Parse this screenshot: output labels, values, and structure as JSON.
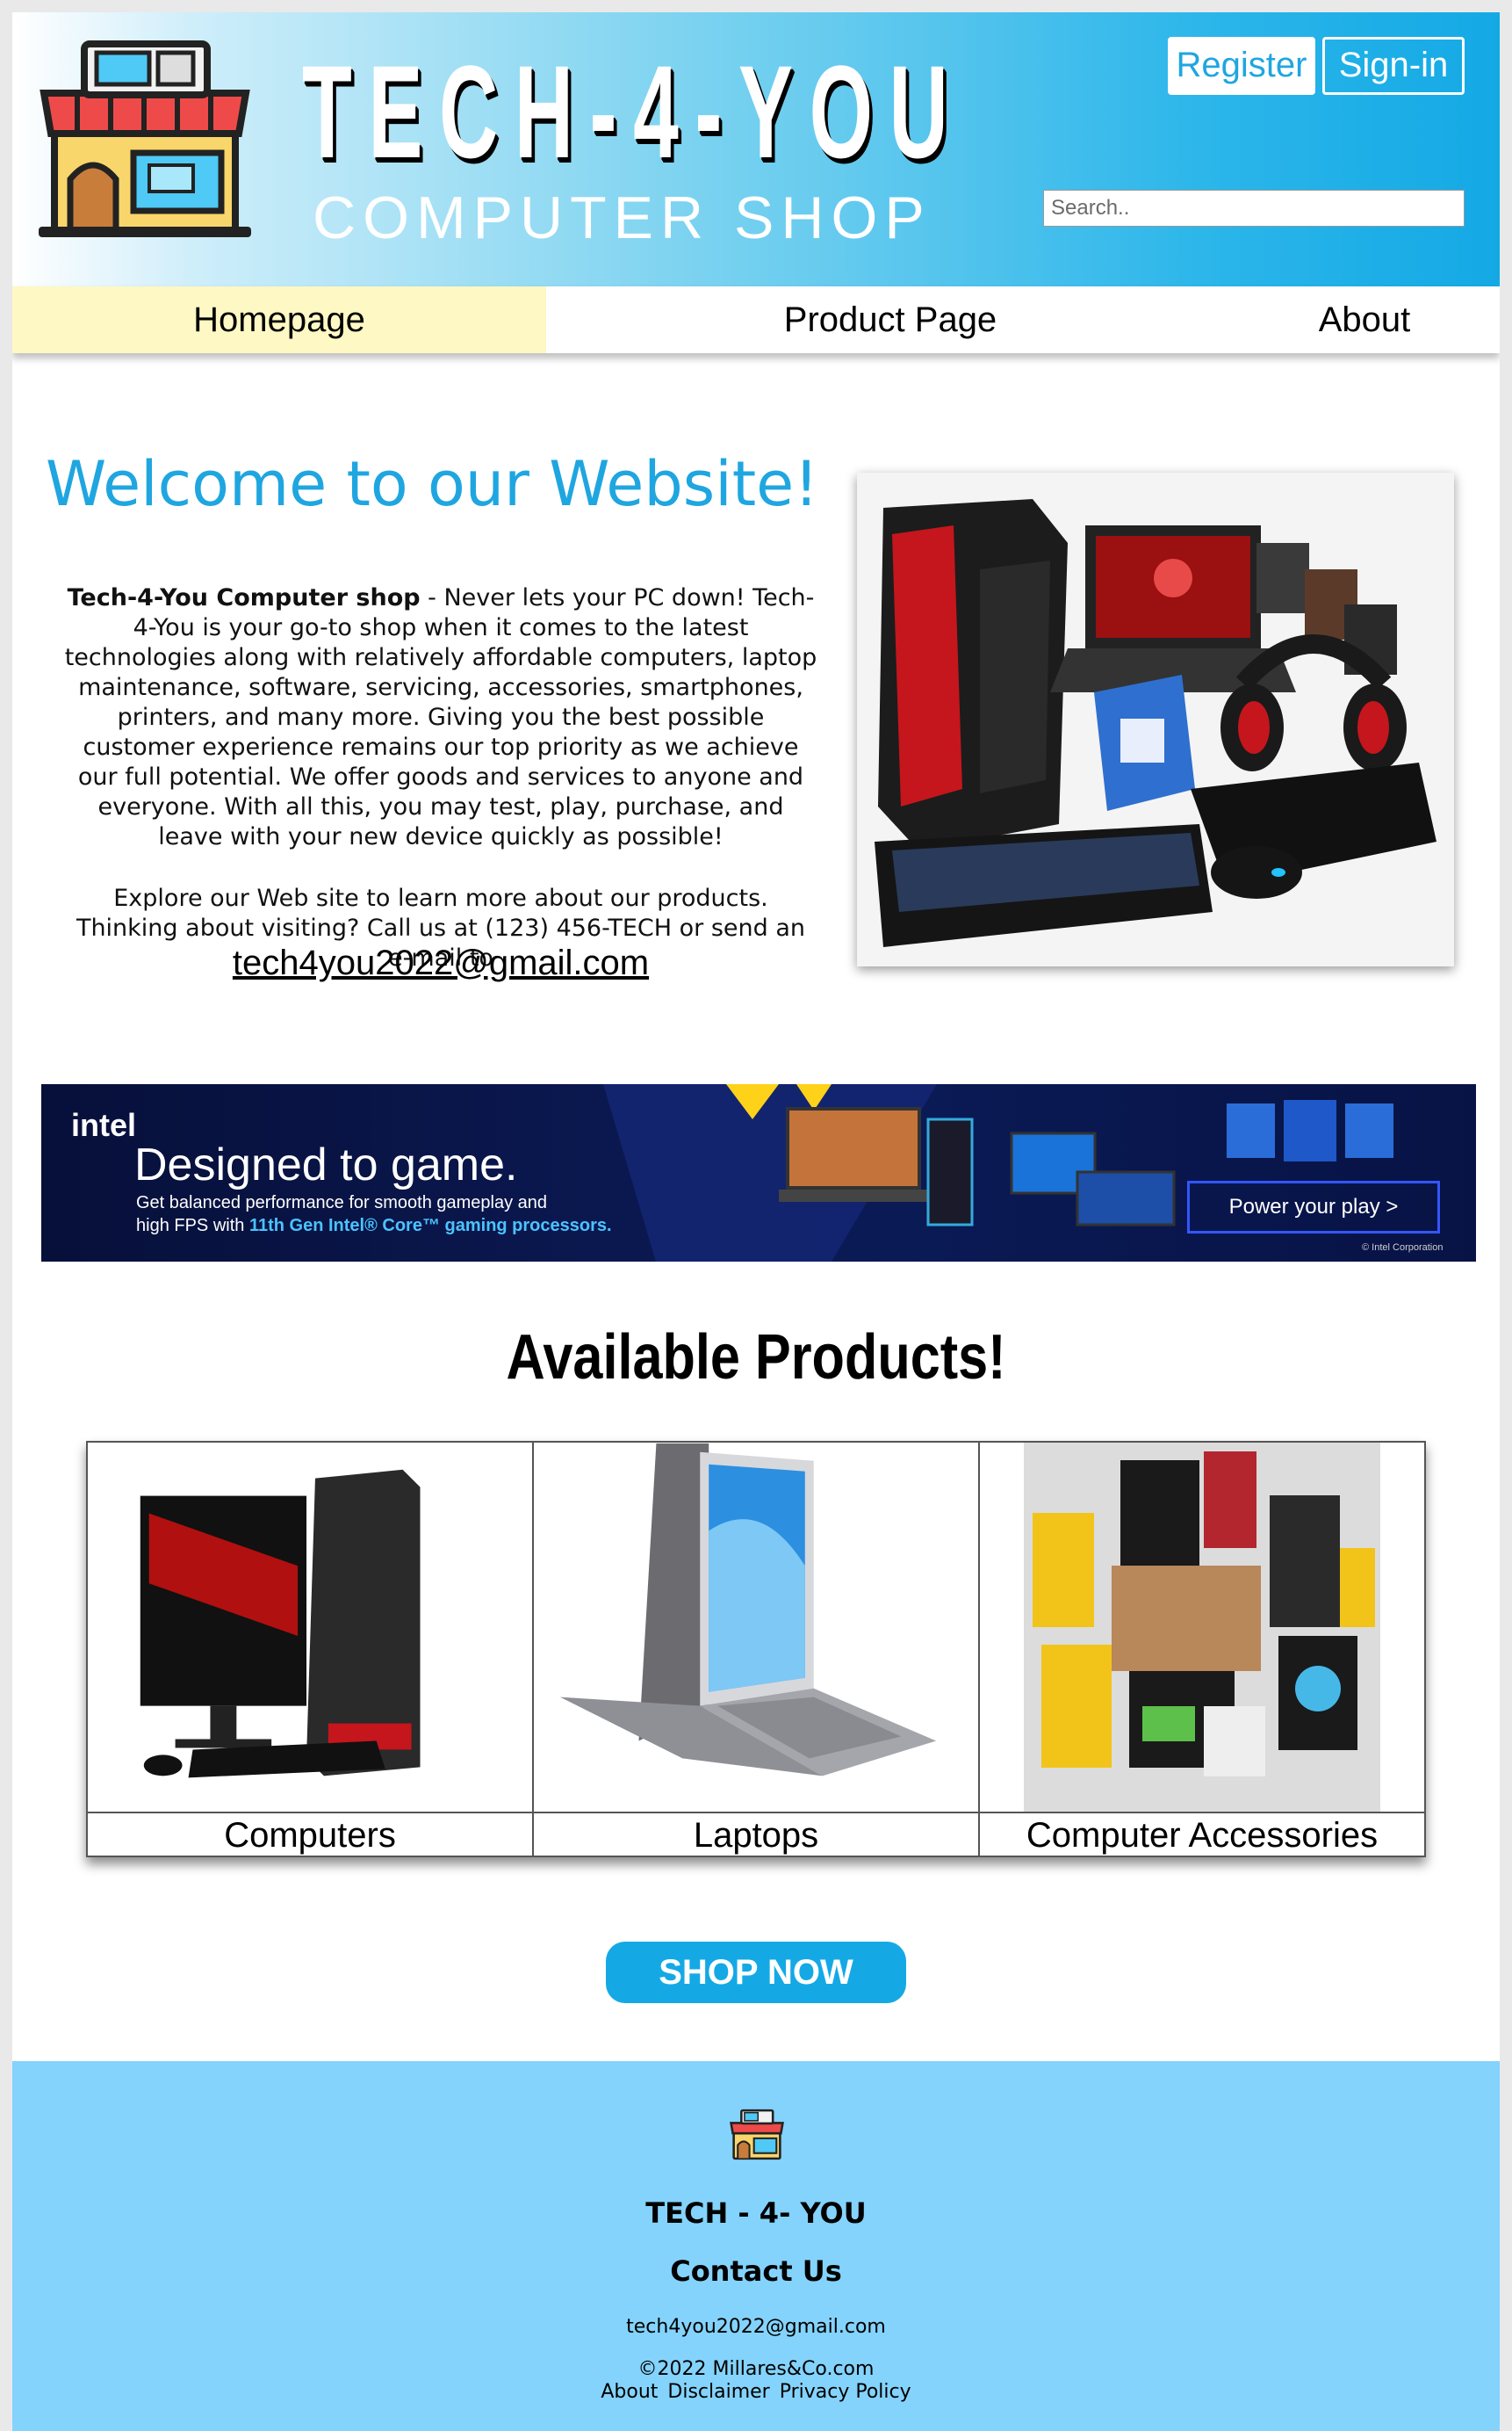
{
  "header": {
    "title": "TECH-4-YOU",
    "subtitle": "COMPUTER SHOP",
    "register_label": "Register",
    "signin_label": "Sign-in",
    "search_placeholder": "Search.."
  },
  "nav": {
    "home": "Homepage",
    "product": "Product Page",
    "about": "About"
  },
  "welcome": {
    "title": "Welcome to our Website!",
    "shop_name": "Tech-4-You Computer shop",
    "body": " - Never lets your PC down! Tech-4-You is your go-to shop when it comes to the latest technologies along with relatively affordable computers, laptop maintenance, software, servicing, accessories, smartphones, printers, and many more. Giving you the best possible customer experience remains our top priority as we achieve our full potential. We offer goods and services to anyone and everyone. With all this, you may test, play, purchase, and leave with your new device quickly as possible!",
    "explore": "Explore our Web site to learn more about our products. Thinking about visiting? Call us at (123) 456-TECH or send an e-mail to",
    "email": "tech4you2022@gmail.com"
  },
  "banner": {
    "brand": "intel",
    "headline": "Designed to game.",
    "line1": "Get balanced performance for smooth gameplay and",
    "line2_prefix": "high FPS with ",
    "line2_highlight": "11th Gen Intel® Core™ gaming processors.",
    "cta": "Power your play >",
    "copyright": "© Intel Corporation"
  },
  "products": {
    "title": "Available Products!",
    "items": [
      "Computers",
      "Laptops",
      "Computer Accessories"
    ]
  },
  "shop_now": "SHOP NOW",
  "footer": {
    "brand": "TECH - 4- YOU",
    "contact": "Contact Us",
    "email": "tech4you2022@gmail.com",
    "copyright": "©2022 Millares&Co.com",
    "links": [
      "About",
      "Disclaimer",
      "Privacy Policy"
    ]
  },
  "colors": {
    "accent": "#1fa6e0",
    "nav_active": "#fdf8c4",
    "footer_bg": "#84d3fc",
    "button": "#14a9e5"
  }
}
